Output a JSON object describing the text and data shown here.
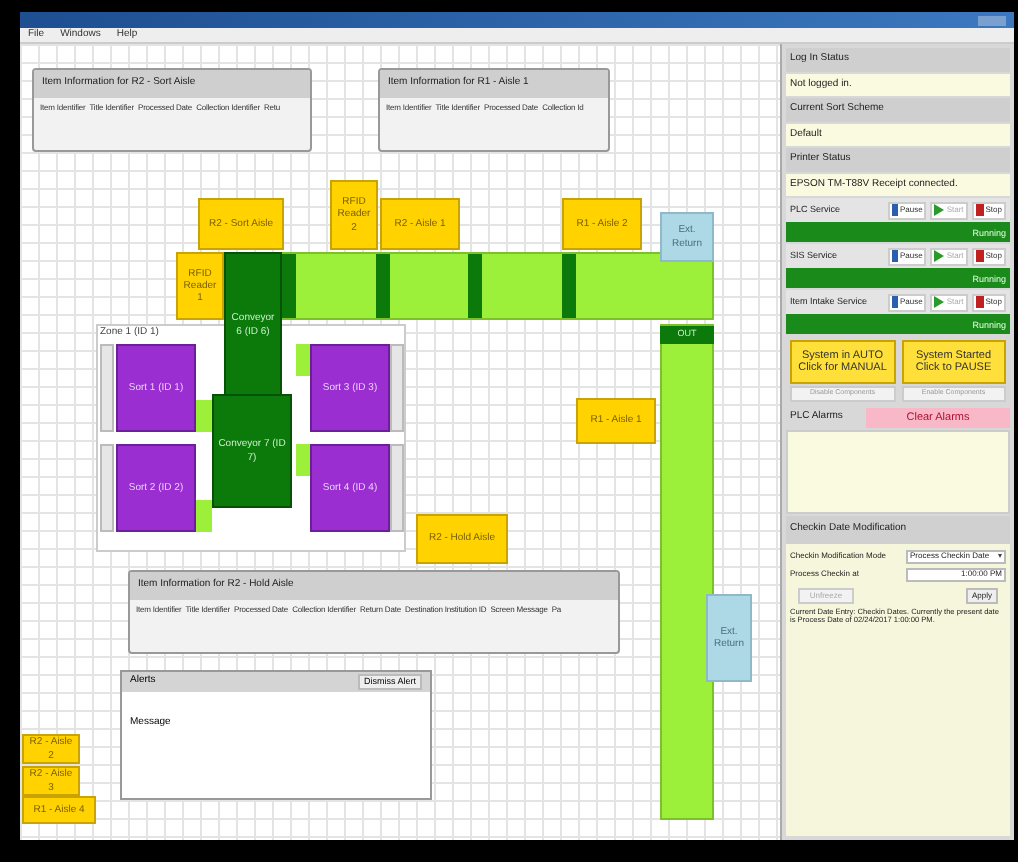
{
  "window": {
    "menu": [
      "File",
      "Windows",
      "Help"
    ]
  },
  "info_panels": [
    {
      "title": "Item Information for R2 - Sort Aisle",
      "columns": [
        "Item Identifier",
        "Title Identifier",
        "Processed Date",
        "Collection Identifier",
        "Retu"
      ]
    },
    {
      "title": "Item Information for R1 - Aisle 1",
      "columns": [
        "Item Identifier",
        "Title Identifier",
        "Processed Date",
        "Collection Id"
      ]
    },
    {
      "title": "Item Information for R2 - Hold Aisle",
      "columns": [
        "Item Identifier",
        "Title Identifier",
        "Processed Date",
        "Collection Identifier",
        "Return Date",
        "Destination Institution ID",
        "Screen Message",
        "Pa"
      ]
    }
  ],
  "zone": {
    "title": "Zone 1 (ID 1)"
  },
  "blocks": [
    {
      "kind": "aisle",
      "label": "R2 - Sort Aisle"
    },
    {
      "kind": "reader",
      "label": "RFID Reader 2"
    },
    {
      "kind": "aisle",
      "label": "R2 - Aisle 1"
    },
    {
      "kind": "aisle",
      "label": "R1 - Aisle 2"
    },
    {
      "kind": "return",
      "label": "Ext. Return"
    },
    {
      "kind": "reader",
      "label": "RFID Reader 1"
    },
    {
      "kind": "conveyor",
      "label": "Conveyor 6 (ID 6)"
    },
    {
      "kind": "sorter",
      "label": "Sort 1 (ID 1)"
    },
    {
      "kind": "sorter",
      "label": "Sort 3 (ID 3)"
    },
    {
      "kind": "conveyor",
      "label": "Conveyor 7 (ID 7)"
    },
    {
      "kind": "sorter",
      "label": "Sort 2 (ID 2)"
    },
    {
      "kind": "sorter",
      "label": "Sort 4 (ID 4)"
    },
    {
      "kind": "aisle",
      "label": "R1 - Aisle 1"
    },
    {
      "kind": "aisle",
      "label": "R2 - Hold Aisle"
    },
    {
      "kind": "return",
      "label": "Ext. Return"
    },
    {
      "kind": "aisle",
      "label": "R2 - Aisle 2"
    },
    {
      "kind": "aisle",
      "label": "R2 - Aisle 3"
    },
    {
      "kind": "aisle",
      "label": "R1 - Aisle 4"
    }
  ],
  "out_label": "OUT",
  "alerts": {
    "title": "Alerts",
    "dismiss": "Dismiss Alert",
    "column": "Message"
  },
  "status": [
    {
      "label": "Log In Status",
      "value": "Not logged in."
    },
    {
      "label": "Current Sort Scheme",
      "value": "Default"
    },
    {
      "label": "Printer Status",
      "value": "EPSON TM-T88V Receipt connected."
    }
  ],
  "services": [
    {
      "name": "PLC Service",
      "pause": "Pause",
      "start": "Start",
      "stop": "Stop",
      "status": "Running",
      "running": true
    },
    {
      "name": "SIS Service",
      "pause": "Pause",
      "start": "Start",
      "stop": "Stop",
      "status": "Running",
      "running": true
    },
    {
      "name": "Item Intake Service",
      "pause": "Pause",
      "start": "Start",
      "stop": "Stop",
      "status": "Running",
      "running": true
    }
  ],
  "mode_buttons": [
    "System in AUTO\nClick for MANUAL",
    "System Started\nClick to PAUSE"
  ],
  "component_buttons": [
    "Disable Components",
    "Enable Components"
  ],
  "alarms": {
    "title": "PLC Alarms",
    "clear": "Clear Alarms"
  },
  "checkin": {
    "title": "Checkin Date Modification",
    "mode_label": "Checkin Modification Mode",
    "mode_value": "Process Checkin Date",
    "date_label": "Process Checkin at",
    "date_value": "1:00:00 PM",
    "cancel": "Unfreeze",
    "apply": "Apply",
    "note": "Current Date Entry: Checkin Dates. Currently the present date is Process Date of 02/24/2017 1:00:00 PM."
  }
}
